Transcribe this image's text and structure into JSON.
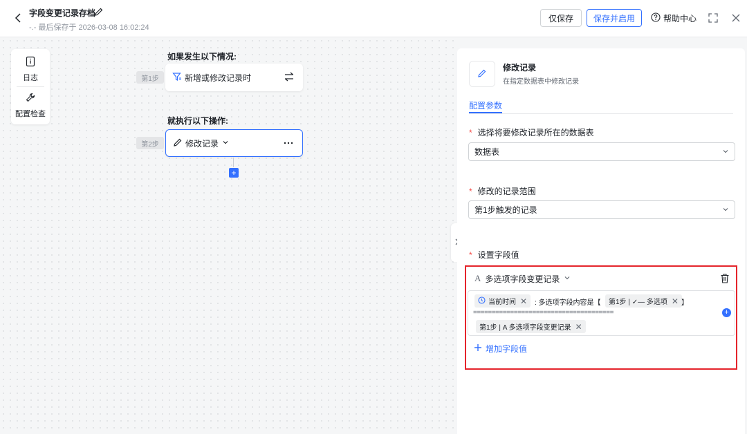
{
  "header": {
    "title": "字段变更记录存档",
    "last_saved": "-.- 最后保存于 2026-03-08 16:02:24",
    "save_only_label": "仅保存",
    "save_enable_label": "保存并启用",
    "help_label": "帮助中心"
  },
  "toolbox": {
    "log_label": "日志",
    "check_label": "配置检查"
  },
  "flow": {
    "trigger_section": "如果发生以下情况:",
    "action_section": "就执行以下操作:",
    "step1_tag": "第1步",
    "step2_tag": "第2步",
    "trigger_node": "新增或修改记录时",
    "action_node": "修改记录",
    "add_symbol": "+"
  },
  "panel": {
    "title": "修改记录",
    "desc": "在指定数据表中修改记录",
    "tab": "配置参数",
    "table_label": "选择将要修改记录所在的数据表",
    "table_value": "数据表",
    "range_label": "修改的记录范围",
    "range_value": "第1步触发的记录",
    "fields_label": "设置字段值",
    "required_mark": "*"
  },
  "field_value": {
    "field_icon": "A",
    "field_name": "多选项字段变更记录",
    "chip_time": "当前时间",
    "text_middle": ": 多选项字段内容是【",
    "chip_multi": "第1步 | ✓— 多选项",
    "text_close": "】",
    "separator": "======================================",
    "chip_ref": "第1步 | A 多选项字段变更记录",
    "add_field_label": "增加字段值"
  },
  "colors": {
    "accent": "#3370ff",
    "highlight_border": "#e5242b",
    "required": "#f54a45"
  }
}
